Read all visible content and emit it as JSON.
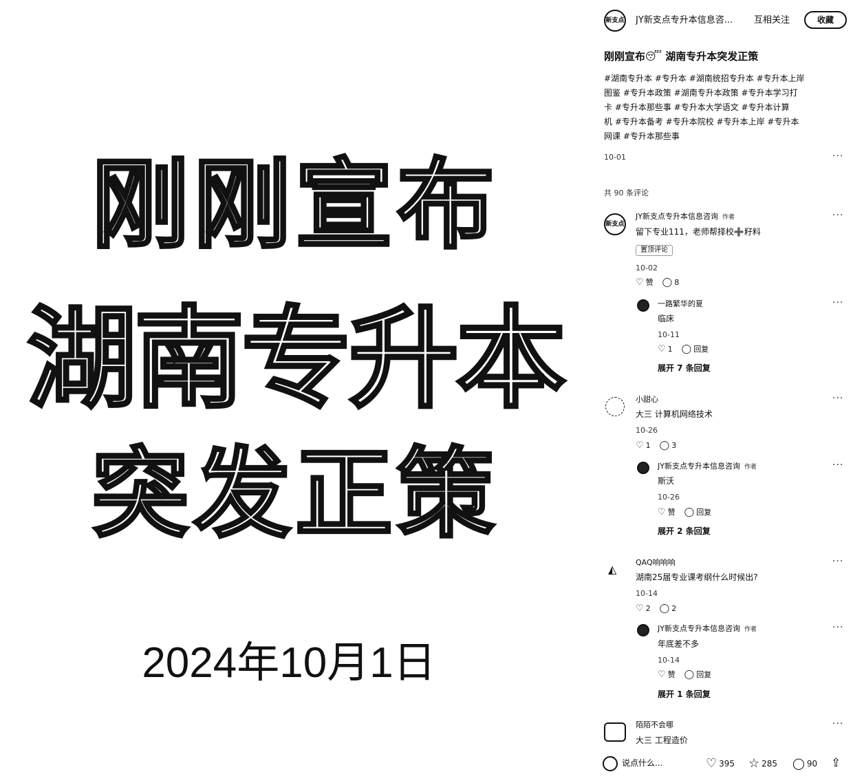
{
  "cover": {
    "line1": "刚刚宣布",
    "line2": "湖南专升本",
    "line3": "突发正策",
    "date": "2024年10月1日"
  },
  "header": {
    "account_name": "JY新支点专升本信息咨...",
    "relation": "互相关注",
    "follow_button": "收藏"
  },
  "post": {
    "title": "刚刚宣布😴 湖南专升本突发正策",
    "tags_lines": [
      "#湖南专升本  #专升本  #湖南统招专升本  #专升本上岸",
      "图鉴  #专升本政策  #湖南专升本政策  #专升本学习打",
      "卡  #专升本那些事  #专升本大学语文  #专升本计算",
      "机  #专升本备考  #专升本院校  #专升本上岸  #专升本",
      "网课  #专升本那些事"
    ],
    "date": "10-01",
    "more": "···"
  },
  "comments_header": "共 90 条评论",
  "comments": {
    "c1": {
      "user": "JY新支点专升本信息咨询",
      "author_tag": "作者",
      "text": "留下专业111，老师帮择校➕籽料",
      "pinned": "置顶评论",
      "date": "10-02",
      "like": "赞",
      "reply_count": "8",
      "reply": {
        "user": "一路繁华的夏",
        "text": "临床",
        "date": "10-11",
        "like_count": "1",
        "reply_label": "回复"
      },
      "expand": "展开 7 条回复"
    },
    "c2": {
      "user": "小甜心",
      "text": "大三 计算机网络技术",
      "date": "10-26",
      "like_count": "1",
      "reply_count": "3",
      "reply": {
        "user": "JY新支点专升本信息咨询",
        "author_tag": "作者",
        "text": "斯沃",
        "date": "10-26",
        "like": "赞",
        "reply_label": "回复"
      },
      "expand": "展开 2 条回复"
    },
    "c3": {
      "user": "QAQ响响响",
      "text": "湖南25届专业课考纲什么时候出?",
      "date": "10-14",
      "like_count": "2",
      "reply_count": "2",
      "reply": {
        "user": "JY新支点专升本信息咨询",
        "author_tag": "作者",
        "text": "年底差不多",
        "date": "10-14",
        "like": "赞",
        "reply_label": "回复"
      },
      "expand": "展开 1 条回复"
    },
    "c4": {
      "user": "陌陌不会哪",
      "text": "大三  工程造价"
    }
  },
  "bottom_bar": {
    "input_placeholder": "说点什么...",
    "likes": "395",
    "stars": "285",
    "comments": "90"
  },
  "icons": {
    "like": "heart-icon",
    "reply": "comment-bubble-icon",
    "star": "star-icon",
    "share": "share-icon",
    "more": "more-dots-icon"
  }
}
